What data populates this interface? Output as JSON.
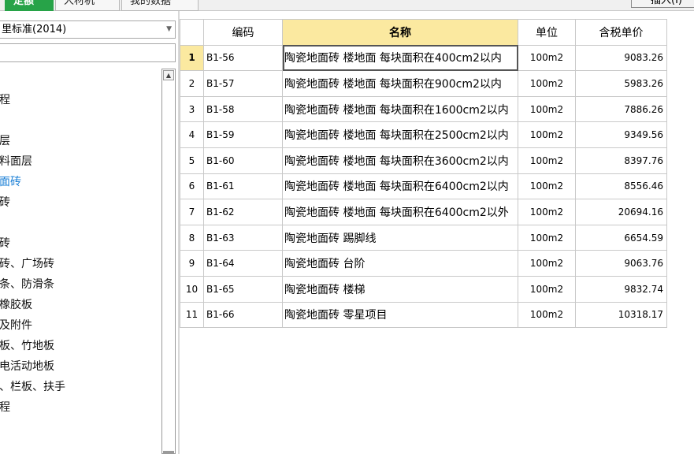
{
  "tabs": [
    {
      "label": "定额",
      "active": true
    },
    {
      "label": "人材机",
      "active": false
    },
    {
      "label": "我的数据",
      "active": false
    }
  ],
  "insert_button": "插入(I)",
  "left_panel": {
    "library_select": "里标准(2014)",
    "search_placeholder": "",
    "tree_items": [
      {
        "label": "程",
        "selected": false
      },
      {
        "label": "层",
        "selected": false
      },
      {
        "label": "料面层",
        "selected": false
      },
      {
        "label": "面砖",
        "selected": true
      },
      {
        "label": "砖",
        "selected": false
      },
      {
        "label": "砖",
        "selected": false
      },
      {
        "label": "砖、广场砖",
        "selected": false
      },
      {
        "label": "条、防滑条",
        "selected": false
      },
      {
        "label": "橡胶板",
        "selected": false
      },
      {
        "label": "及附件",
        "selected": false
      },
      {
        "label": "板、竹地板",
        "selected": false
      },
      {
        "label": "电活动地板",
        "selected": false
      },
      {
        "label": "、栏板、扶手",
        "selected": false
      },
      {
        "label": "程",
        "selected": false
      }
    ]
  },
  "grid": {
    "columns": [
      "",
      "编码",
      "名称",
      "单位",
      "含税单价"
    ],
    "highlighted_column": 2,
    "current_row": 0,
    "rows": [
      {
        "n": "1",
        "code": "B1-56",
        "name": "陶瓷地面砖 楼地面 每块面积在400cm2以内",
        "unit": "100m2",
        "price": "9083.26"
      },
      {
        "n": "2",
        "code": "B1-57",
        "name": "陶瓷地面砖 楼地面 每块面积在900cm2以内",
        "unit": "100m2",
        "price": "5983.26"
      },
      {
        "n": "3",
        "code": "B1-58",
        "name": "陶瓷地面砖 楼地面 每块面积在1600cm2以内",
        "unit": "100m2",
        "price": "7886.26"
      },
      {
        "n": "4",
        "code": "B1-59",
        "name": "陶瓷地面砖 楼地面 每块面积在2500cm2以内",
        "unit": "100m2",
        "price": "9349.56"
      },
      {
        "n": "5",
        "code": "B1-60",
        "name": "陶瓷地面砖 楼地面 每块面积在3600cm2以内",
        "unit": "100m2",
        "price": "8397.76"
      },
      {
        "n": "6",
        "code": "B1-61",
        "name": "陶瓷地面砖 楼地面 每块面积在6400cm2以内",
        "unit": "100m2",
        "price": "8556.46"
      },
      {
        "n": "7",
        "code": "B1-62",
        "name": "陶瓷地面砖 楼地面 每块面积在6400cm2以外",
        "unit": "100m2",
        "price": "20694.16"
      },
      {
        "n": "8",
        "code": "B1-63",
        "name": "陶瓷地面砖 踢脚线",
        "unit": "100m2",
        "price": "6654.59"
      },
      {
        "n": "9",
        "code": "B1-64",
        "name": "陶瓷地面砖 台阶",
        "unit": "100m2",
        "price": "9063.76"
      },
      {
        "n": "10",
        "code": "B1-65",
        "name": "陶瓷地面砖 楼梯",
        "unit": "100m2",
        "price": "9832.74"
      },
      {
        "n": "11",
        "code": "B1-66",
        "name": "陶瓷地面砖 零星项目",
        "unit": "100m2",
        "price": "10318.17"
      }
    ]
  },
  "colors": {
    "active_tab": "#27a348",
    "header_highlight": "#fbe9a0",
    "tree_selected": "#1a7fd6"
  }
}
